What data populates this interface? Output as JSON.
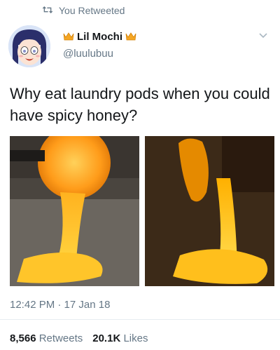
{
  "social_context": {
    "text": "You Retweeted",
    "icon": "retweet-icon"
  },
  "author": {
    "display_name": "Lil Mochi",
    "handle": "@luulubuu",
    "name_emoji": "crown-icon",
    "emoji_color": "#f5a623"
  },
  "tweet": {
    "text": "Why eat laundry pods when you could have spicy honey?",
    "timestamp": "12:42 PM · 17 Jan 18"
  },
  "stats": {
    "retweets_count": "8,566",
    "retweets_label": "Retweets",
    "likes_count": "20.1K",
    "likes_label": "Likes"
  },
  "colors": {
    "muted": "#657786",
    "text": "#14171a",
    "glow": "#ffb000"
  }
}
